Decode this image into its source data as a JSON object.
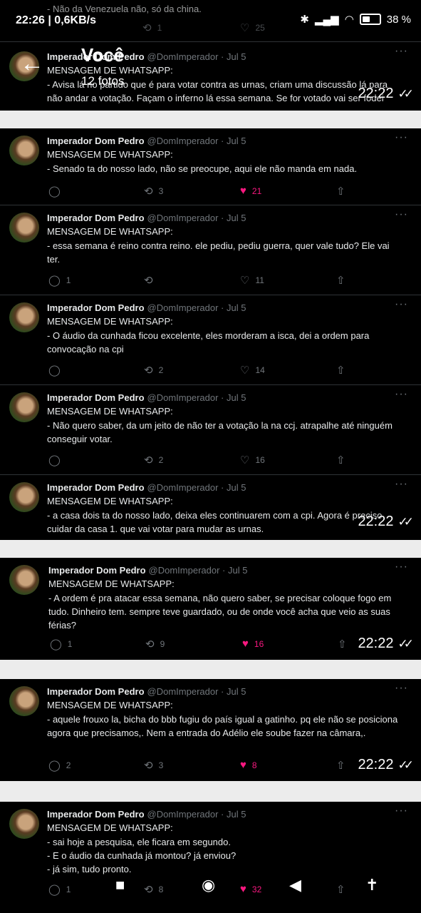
{
  "status_bar": {
    "time": "22:26 | 0,6KB/s",
    "battery": "38 %",
    "icons": [
      "bluetooth-icon",
      "signal-icon",
      "wifi-icon",
      "battery-icon"
    ]
  },
  "header": {
    "title": "Você",
    "subtitle": "12 fotos",
    "back_icon": "arrow-left-icon"
  },
  "shots": [
    {
      "top_fragment": {
        "text": "- Não da Venezuela não, só da china.",
        "retweets": "1",
        "likes": "25"
      },
      "tweets": [
        {
          "name": "Imperador Dom Pedro",
          "handle": "@DomImperador · Jul 5",
          "label": "MENSAGEM DE WHATSAPP:",
          "body": "- Avisa lá no partido que é para votar contra as urnas, criam uma discussão lá para não andar a votação. Façam o inferno lá essa semana. Se for votado vai ser fodei",
          "replies": "",
          "retweets": "",
          "likes": "",
          "liked": false
        }
      ],
      "timestamp": "22:22"
    },
    {
      "tweets": [
        {
          "name": "Imperador Dom Pedro",
          "handle": "@DomImperador · Jul 5",
          "label": "MENSAGEM DE WHATSAPP:",
          "body": "- Senado ta do nosso lado, não se preocupe, aqui ele não manda em nada.",
          "replies": "",
          "retweets": "3",
          "likes": "21",
          "liked": true
        },
        {
          "name": "Imperador Dom Pedro",
          "handle": "@DomImperador · Jul 5",
          "label": "MENSAGEM DE WHATSAPP:",
          "body": "- essa semana é reino contra reino. ele pediu, pediu guerra, quer vale tudo? Ele vai ter.",
          "replies": "1",
          "retweets": "",
          "likes": "11",
          "liked": false
        },
        {
          "name": "Imperador Dom Pedro",
          "handle": "@DomImperador · Jul 5",
          "label": "MENSAGEM DE WHATSAPP:",
          "body": "- O áudio da cunhada ficou excelente, eles morderam a isca, dei a ordem para convocação na cpi",
          "replies": "",
          "retweets": "2",
          "likes": "14",
          "liked": false
        },
        {
          "name": "Imperador Dom Pedro",
          "handle": "@DomImperador · Jul 5",
          "label": "MENSAGEM DE WHATSAPP:",
          "body": "- Não quero saber, da um jeito de não ter a votação la na ccj. atrapalhe até ninguém conseguir votar.",
          "replies": "",
          "retweets": "2",
          "likes": "16",
          "liked": false
        },
        {
          "name": "Imperador Dom Pedro",
          "handle": "@DomImperador · Jul 5",
          "label": "MENSAGEM DE WHATSAPP:",
          "body": "-  a casa dois ta do nosso lado, deixa eles continuarem com a cpi. Agora é preciso cuidar da casa 1. que vai votar para mudar as urnas.",
          "replies": "",
          "retweets": "",
          "likes": "",
          "liked": false
        }
      ],
      "timestamp": "22:22"
    },
    {
      "tweets": [
        {
          "name": "Imperador Dom Pedro",
          "handle": "@DomImperador · Jul 5",
          "label": "MENSAGEM DE WHATSAPP:",
          "body": "- A ordem é pra atacar essa semana, não quero saber, se precisar coloque fogo em tudo. Dinheiro tem. sempre teve guardado, ou de onde você acha que veio as suas férias?",
          "replies": "1",
          "retweets": "9",
          "likes": "16",
          "liked": true
        }
      ],
      "timestamp": "22:22"
    },
    {
      "tweets": [
        {
          "name": "Imperador Dom Pedro",
          "handle": "@DomImperador · Jul 5",
          "label": "MENSAGEM DE WHATSAPP:",
          "body": "- aquele frouxo la, bicha do bbb  fugiu do país igual a gatinho. pq ele não se posiciona agora que precisamos,. Nem a entrada do Adélio ele soube fazer na câmara,.",
          "replies": "2",
          "retweets": "3",
          "likes": "8",
          "liked": true
        }
      ],
      "timestamp": "22:22"
    },
    {
      "tweets": [
        {
          "name": "Imperador Dom Pedro",
          "handle": "@DomImperador · Jul 5",
          "label": "MENSAGEM DE WHATSAPP:",
          "body": "- sai hoje a pesquisa, ele ficara em segundo.\n- E o áudio da cunhada já montou? já enviou?\n- já sim, tudo pronto.",
          "replies": "1",
          "retweets": "8",
          "likes": "32",
          "liked": true
        }
      ]
    }
  ],
  "navbar": {
    "buttons": [
      "square-icon",
      "home-circle-icon",
      "back-triangle-icon",
      "accessibility-icon"
    ]
  }
}
